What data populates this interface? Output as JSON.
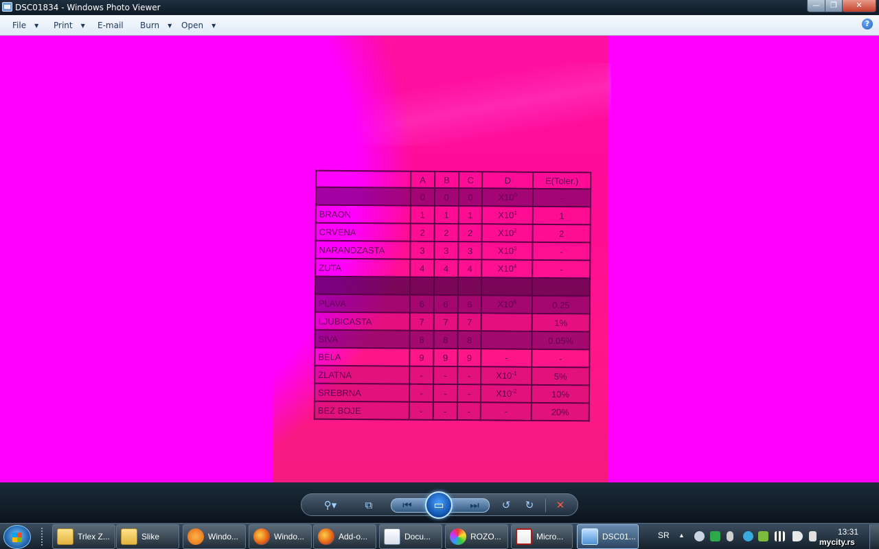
{
  "window": {
    "title": "DSC01834 - Windows Photo Viewer",
    "minimize_glyph": "—",
    "maximize_glyph": "❐",
    "close_glyph": "✕"
  },
  "menubar": {
    "items": [
      {
        "label": "File",
        "has_dropdown": true
      },
      {
        "label": "Print",
        "has_dropdown": true
      },
      {
        "label": "E-mail",
        "has_dropdown": false
      },
      {
        "label": "Burn",
        "has_dropdown": true
      },
      {
        "label": "Open",
        "has_dropdown": true
      }
    ],
    "help_glyph": "?"
  },
  "photo": {
    "background_color": "#ff00ff",
    "table": {
      "headers": [
        "",
        "A",
        "B",
        "C",
        "D",
        "E(Toler.)"
      ],
      "rows": [
        {
          "name": "",
          "a": "0",
          "b": "0",
          "c": "0",
          "mult": "X10",
          "exp": "0",
          "tol": "-"
        },
        {
          "name": "BRAON",
          "a": "1",
          "b": "1",
          "c": "1",
          "mult": "X10",
          "exp": "1",
          "tol": "1"
        },
        {
          "name": "CRVENA",
          "a": "2",
          "b": "2",
          "c": "2",
          "mult": "X10",
          "exp": "2",
          "tol": "2"
        },
        {
          "name": "NARANDZASTA",
          "a": "3",
          "b": "3",
          "c": "3",
          "mult": "X10",
          "exp": "3",
          "tol": "-"
        },
        {
          "name": "ZUTA",
          "a": "4",
          "b": "4",
          "c": "4",
          "mult": "X10",
          "exp": "4",
          "tol": "-"
        },
        {
          "name": "",
          "a": "",
          "b": "",
          "c": "",
          "mult": "",
          "exp": "",
          "tol": ""
        },
        {
          "name": "PLAVA",
          "a": "6",
          "b": "6",
          "c": "6",
          "mult": "X10",
          "exp": "6",
          "tol": "0.25"
        },
        {
          "name": "LJUBICASTA",
          "a": "7",
          "b": "7",
          "c": "7",
          "mult": "",
          "exp": "",
          "tol": "1%"
        },
        {
          "name": "SIVA",
          "a": "8",
          "b": "8",
          "c": "8",
          "mult": "",
          "exp": "",
          "tol": "0.05%"
        },
        {
          "name": "BELA",
          "a": "9",
          "b": "9",
          "c": "9",
          "mult": "-",
          "exp": "",
          "tol": "-"
        },
        {
          "name": "ZLATNA",
          "a": "-",
          "b": "-",
          "c": "-",
          "mult": "X10",
          "exp": "-1",
          "tol": "5%"
        },
        {
          "name": "SREBRNA",
          "a": "-",
          "b": "-",
          "c": "-",
          "mult": "X10",
          "exp": "-2",
          "tol": "10%"
        },
        {
          "name": "BEZ BOJE",
          "a": "-",
          "b": "-",
          "c": "-",
          "mult": "-",
          "exp": "",
          "tol": "20%"
        }
      ]
    }
  },
  "controls": {
    "zoom_glyph": "⚲▾",
    "actual_size_glyph": "⧉",
    "previous_glyph": "⏮",
    "slideshow_glyph": "▭",
    "next_glyph": "⏭",
    "rotate_left_glyph": "↺",
    "rotate_right_glyph": "↻",
    "delete_glyph": "✕"
  },
  "taskbar": {
    "buttons": [
      {
        "label": "Trlex Z...",
        "icon": "folder-icon",
        "active": false
      },
      {
        "label": "Slike",
        "icon": "folder-icon",
        "active": false
      },
      {
        "label": "Windo...",
        "icon": "media-player-icon",
        "active": false
      },
      {
        "label": "Windo...",
        "icon": "firefox-icon",
        "active": false
      },
      {
        "label": "Add-o...",
        "icon": "firefox-icon",
        "active": false
      },
      {
        "label": "Docu...",
        "icon": "word-document-icon",
        "active": false
      },
      {
        "label": "ROZO...",
        "icon": "paint-icon",
        "active": false
      },
      {
        "label": "Micro...",
        "icon": "microsoft-app-icon",
        "active": false
      },
      {
        "label": "DSC01...",
        "icon": "photo-viewer-icon",
        "active": true
      }
    ],
    "tray": {
      "language": "SR",
      "arrow_glyph": "▲",
      "time": "13:31",
      "watermark": "mycity.rs"
    }
  }
}
